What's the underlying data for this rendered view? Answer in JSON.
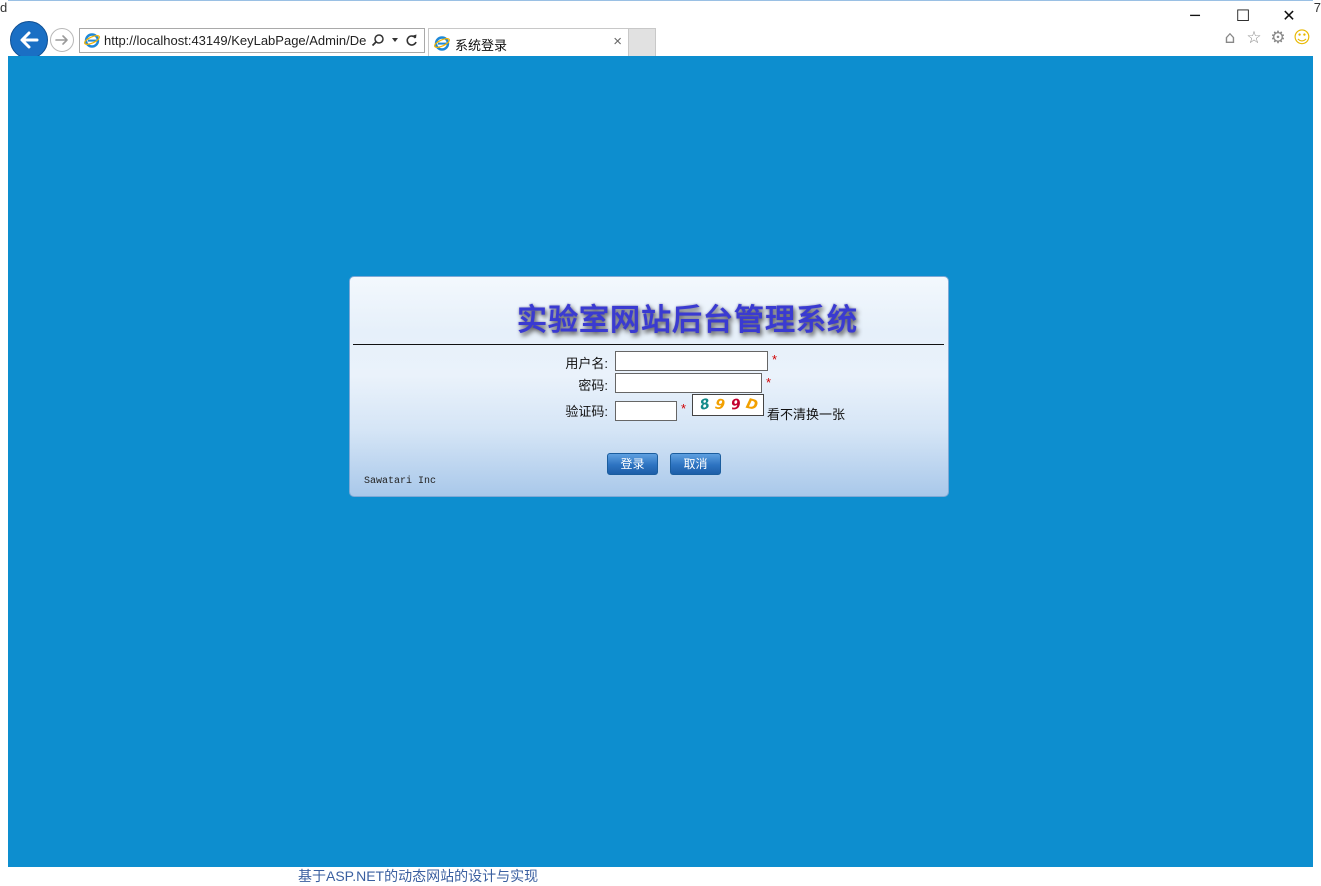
{
  "browser": {
    "url": "http://localhost:43149/KeyLabPage/Admin/De",
    "tab_title": "系统登录",
    "tab_close": "×",
    "window_controls": {
      "minimize": "─",
      "maximize": "☐",
      "close": "✕"
    },
    "toolbar_icons": [
      "home-icon",
      "favorites-star-icon",
      "settings-gear-icon",
      "feedback-smiley-icon"
    ]
  },
  "edge_left": "d",
  "edge_right": "7",
  "login": {
    "title": "实验室网站后台管理系统",
    "username_label": "用户名:",
    "password_label": "密码:",
    "captcha_label": "验证码:",
    "username_value": "",
    "password_value": "",
    "captcha_value": "",
    "required_mark": "*",
    "captcha_chars": [
      "8",
      "9",
      "9",
      "D"
    ],
    "refresh_link": "看不清换一张",
    "login_button": "登录",
    "cancel_button": "取消",
    "footer": "Sawatari Inc"
  },
  "colors": {
    "page_background": "#0d8ecf",
    "title_color": "#3a3ad1",
    "required_color": "#d00000",
    "button_blue": "#2d73c1"
  },
  "bottom_link": "基于ASP.NET的动态网站的设计与实现"
}
